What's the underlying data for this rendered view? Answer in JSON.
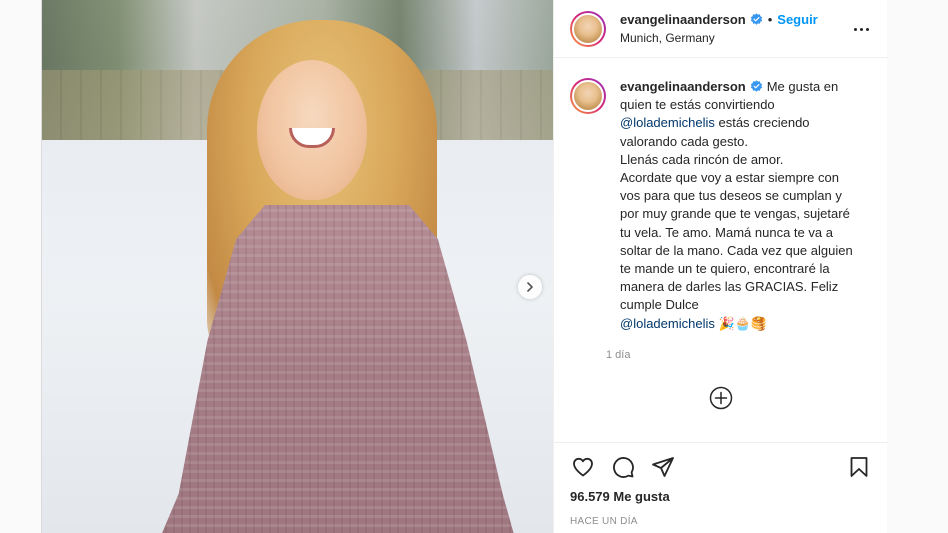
{
  "post": {
    "username": "evangelinaanderson",
    "follow_label": "Seguir",
    "separator": "•",
    "location": "Munich, Germany",
    "caption": {
      "line1": "Me gusta en quien te estás convirtiendo",
      "mention1": "@lolademichelis",
      "line2": "estás creciendo valorando cada gesto.",
      "line3": "Llenás cada rincón de amor.",
      "line4": "Acordate que voy a estar siempre con vos para que tus deseos se cumplan y por muy grande que te vengas, sujetaré tu vela. Te amo. Mamá nunca te va a soltar de la mano. Cada vez que alguien te mande un te quiero, encontraré la manera de darles las GRACIAS. Feliz cumple Dulce",
      "mention2": "@lolademichelis",
      "emojis": "🎉🧁🥞"
    },
    "comment_time": "1 día",
    "likes": "96.579 Me gusta",
    "posted_ago": "HACE UN DÍA"
  },
  "icons": {
    "verified": "verified-badge-icon",
    "more": "more-options-icon",
    "next": "chevron-right-icon",
    "add": "add-circle-icon",
    "like": "heart-icon",
    "comment": "comment-icon",
    "share": "share-icon",
    "save": "bookmark-icon"
  },
  "colors": {
    "accent": "#0095f6",
    "verified": "#3897f0",
    "mention": "#00376b",
    "muted": "#8e8e8e"
  }
}
